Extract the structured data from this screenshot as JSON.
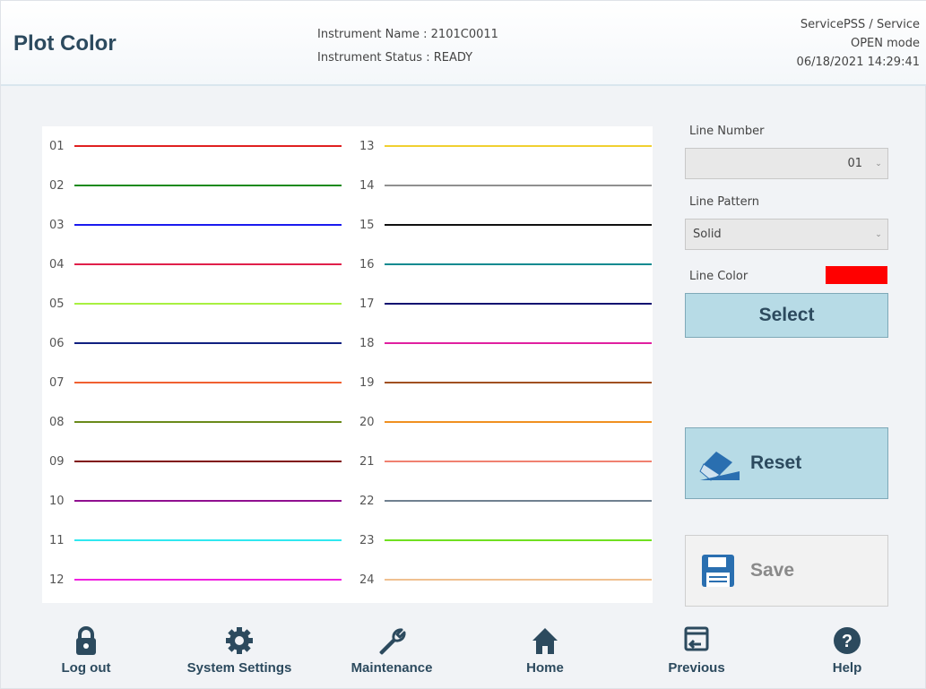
{
  "header": {
    "title": "Plot Color",
    "instrument_name": "Instrument Name : 2101C0011",
    "instrument_status": "Instrument Status : READY",
    "user": "ServicePSS / Service",
    "mode": "OPEN mode",
    "datetime": "06/18/2021 14:29:41"
  },
  "lines": [
    {
      "num": "01",
      "color": "#e02020"
    },
    {
      "num": "02",
      "color": "#1a8a1a"
    },
    {
      "num": "03",
      "color": "#1a1aee"
    },
    {
      "num": "04",
      "color": "#e0204a"
    },
    {
      "num": "05",
      "color": "#a8f040"
    },
    {
      "num": "06",
      "color": "#102080"
    },
    {
      "num": "07",
      "color": "#f06030"
    },
    {
      "num": "08",
      "color": "#6a8a1a"
    },
    {
      "num": "09",
      "color": "#801010"
    },
    {
      "num": "10",
      "color": "#901090"
    },
    {
      "num": "11",
      "color": "#30e8f0"
    },
    {
      "num": "12",
      "color": "#f020e0"
    },
    {
      "num": "13",
      "color": "#f0d030"
    },
    {
      "num": "14",
      "color": "#909090"
    },
    {
      "num": "15",
      "color": "#101010"
    },
    {
      "num": "16",
      "color": "#108a90"
    },
    {
      "num": "17",
      "color": "#101070"
    },
    {
      "num": "18",
      "color": "#e020a0"
    },
    {
      "num": "19",
      "color": "#a05020"
    },
    {
      "num": "20",
      "color": "#f09020"
    },
    {
      "num": "21",
      "color": "#f08070"
    },
    {
      "num": "22",
      "color": "#708090"
    },
    {
      "num": "23",
      "color": "#70e020"
    },
    {
      "num": "24",
      "color": "#f0c090"
    }
  ],
  "controls": {
    "line_number_label": "Line Number",
    "line_number_value": "01",
    "line_pattern_label": "Line Pattern",
    "line_pattern_value": "Solid",
    "line_color_label": "Line Color",
    "line_color_value": "#ff0000",
    "select_label": "Select",
    "reset_label": "Reset",
    "save_label": "Save"
  },
  "footer": {
    "logout": "Log out",
    "system_settings": "System Settings",
    "maintenance": "Maintenance",
    "home": "Home",
    "previous": "Previous",
    "help": "Help"
  }
}
